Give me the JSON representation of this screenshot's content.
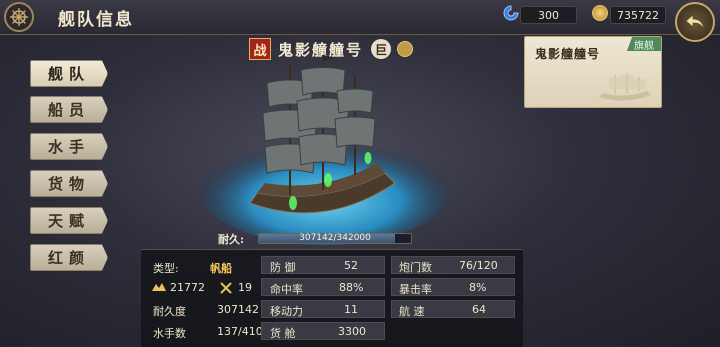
{
  "header": {
    "title": "舰队信息",
    "resource1": "300",
    "resource2": "735722"
  },
  "menu": {
    "items": [
      "舰队",
      "船员",
      "水手",
      "货物",
      "天赋",
      "红颜"
    ],
    "active_index": 0
  },
  "ship": {
    "war_badge": "战",
    "name": "鬼影艟艟号",
    "size_badge": "巨",
    "durability_label": "耐久:",
    "durability_text": "307142/342000",
    "durability_fraction": 0.898
  },
  "fleet_card": {
    "name": "鬼影艟艟号",
    "tag": "旗舰"
  },
  "stats": {
    "type_label": "类型:",
    "type_value": "帆船",
    "power_value": "21772",
    "swords_value": "19",
    "durability_label": "耐久度",
    "durability_value": "307142",
    "sailors_label": "水手数",
    "sailors_value": "137/410",
    "defense_label": "防 御",
    "defense_value": "52",
    "hit_label": "命中率",
    "hit_value": "88%",
    "move_label": "移动力",
    "move_value": "11",
    "cargo_label": "货 舱",
    "cargo_value": "3300",
    "gun_label": "炮门数",
    "gun_value": "76/120",
    "crit_label": "暴击率",
    "crit_value": "8%",
    "speed_label": "航 速",
    "speed_value": "64"
  },
  "colors": {
    "accent_gold": "#c8a668",
    "war_red": "#a3241c",
    "flagship_green": "#4c8a5e",
    "sail_type": "#f2c65a"
  }
}
